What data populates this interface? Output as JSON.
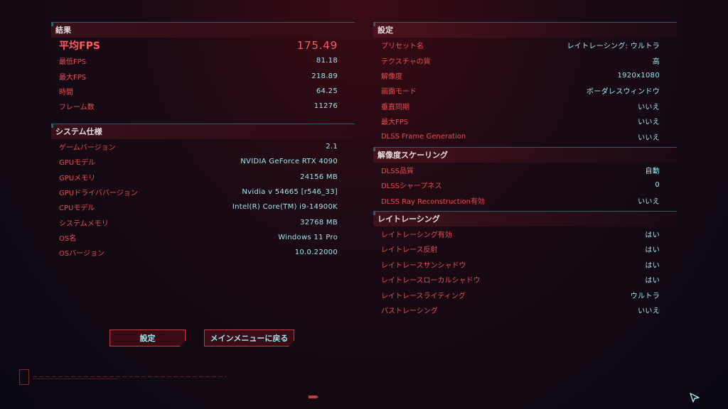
{
  "results": {
    "header": "結果",
    "avg_fps": {
      "label": "平均FPS",
      "value": "175.49"
    },
    "rows": [
      {
        "label": "最低FPS",
        "value": "81.18"
      },
      {
        "label": "最大FPS",
        "value": "218.89"
      },
      {
        "label": "時間",
        "value": "64.25"
      },
      {
        "label": "フレーム数",
        "value": "11276"
      }
    ]
  },
  "system": {
    "header": "システム仕様",
    "rows": [
      {
        "label": "ゲームバージョン",
        "value": "2.1"
      },
      {
        "label": "GPUモデル",
        "value": "NVIDIA GeForce RTX 4090"
      },
      {
        "label": "GPUメモリ",
        "value": "24156 MB"
      },
      {
        "label": "GPUドライババージョン",
        "value": "Nvidia v 54665 [r546_33]"
      },
      {
        "label": "CPUモデル",
        "value": "Intel(R) Core(TM) i9-14900K"
      },
      {
        "label": "システムメモリ",
        "value": "32768 MB"
      },
      {
        "label": "OS名",
        "value": "Windows 11 Pro"
      },
      {
        "label": "OSバージョン",
        "value": "10.0.22000"
      }
    ]
  },
  "settings": {
    "header": "設定",
    "rows": [
      {
        "label": "プリセット名",
        "value": "レイトレーシング: ウルトラ"
      },
      {
        "label": "テクスチャの質",
        "value": "高"
      },
      {
        "label": "解像度",
        "value": "1920x1080"
      },
      {
        "label": "画面モード",
        "value": "ボーダレスウィンドウ"
      },
      {
        "label": "垂直同期",
        "value": "いいえ"
      },
      {
        "label": "最大FPS",
        "value": "いいえ"
      },
      {
        "label": "DLSS Frame Generation",
        "value": "いいえ"
      }
    ]
  },
  "scaling": {
    "header": "解像度スケーリング",
    "rows": [
      {
        "label": "DLSS品質",
        "value": "自動"
      },
      {
        "label": "DLSSシャープネス",
        "value": "0"
      },
      {
        "label": "DLSS Ray Reconstruction有効",
        "value": "いいえ"
      }
    ]
  },
  "raytracing": {
    "header": "レイトレーシング",
    "rows": [
      {
        "label": "レイトレーシング有効",
        "value": "はい"
      },
      {
        "label": "レイトレース反射",
        "value": "はい"
      },
      {
        "label": "レイトレースサンシャドウ",
        "value": "はい"
      },
      {
        "label": "レイトレースローカルシャドウ",
        "value": "はい"
      },
      {
        "label": "レイトレースライティング",
        "value": "ウルトラ"
      },
      {
        "label": "パストレーシング",
        "value": "いいえ"
      }
    ]
  },
  "buttons": {
    "settings": "設定",
    "main_menu": "メインメニューに戻る"
  },
  "colors": {
    "label": "#ea4c52",
    "value": "#9fe7ef",
    "divider": "#2f5d63",
    "button_border": "#c33a42"
  },
  "icons": [
    "cursor-arrow-icon",
    "arrow-marker-icon",
    "version-badge-icon"
  ]
}
